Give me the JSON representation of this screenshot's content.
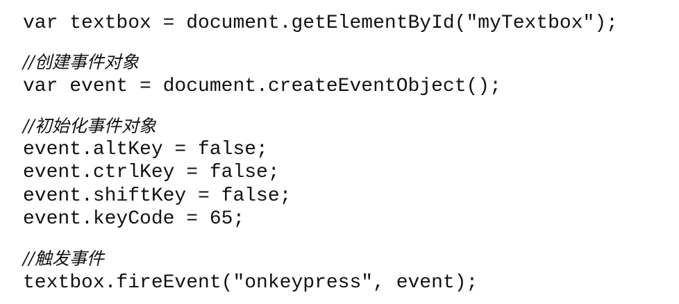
{
  "code": {
    "line_1": "var textbox = document.getElementById(\"myTextbox\");",
    "comment_1": "//创建事件对象",
    "line_2": "var event = document.createEventObject();",
    "comment_2": "//初始化事件对象",
    "line_3": "event.altKey = false;",
    "line_4": "event.ctrlKey = false;",
    "line_5": "event.shiftKey = false;",
    "line_6": "event.keyCode = 65;",
    "comment_3": "//触发事件",
    "line_7": "textbox.fireEvent(\"onkeypress\", event);"
  }
}
